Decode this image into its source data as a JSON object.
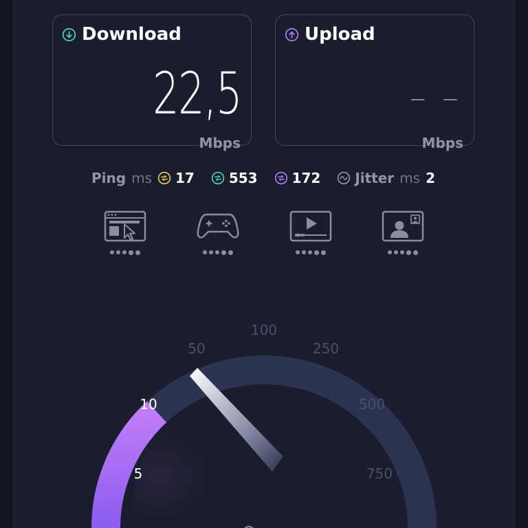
{
  "download": {
    "title": "Download",
    "value": "22,5",
    "unit": "Mbps",
    "icon": "arrow-down-circle-icon",
    "icon_color": "#4fd1c5"
  },
  "upload": {
    "title": "Upload",
    "value": "– –",
    "unit": "Mbps",
    "icon": "arrow-up-circle-icon",
    "icon_color": "#b07cf5"
  },
  "stats": {
    "ping_label": "Ping",
    "ping_unit": "ms",
    "idle_value": "17",
    "download_value": "553",
    "upload_value": "172",
    "jitter_label": "Jitter",
    "jitter_unit": "ms",
    "jitter_value": "2",
    "idle_color": "#f2c94c",
    "download_color": "#4fd1c5",
    "upload_color": "#b07cf5"
  },
  "activities": [
    {
      "icon": "browsing-icon",
      "rating": 5
    },
    {
      "icon": "gaming-icon",
      "rating": 5
    },
    {
      "icon": "streaming-icon",
      "rating": 5
    },
    {
      "icon": "video-call-icon",
      "rating": 5
    }
  ],
  "gauge": {
    "labels": [
      "5",
      "10",
      "50",
      "100",
      "250",
      "500",
      "750"
    ],
    "active_labels": [
      "5",
      "10"
    ],
    "current_value": 22.5,
    "arc_color": "#2b3350",
    "progress_color": "#b77cf6"
  }
}
